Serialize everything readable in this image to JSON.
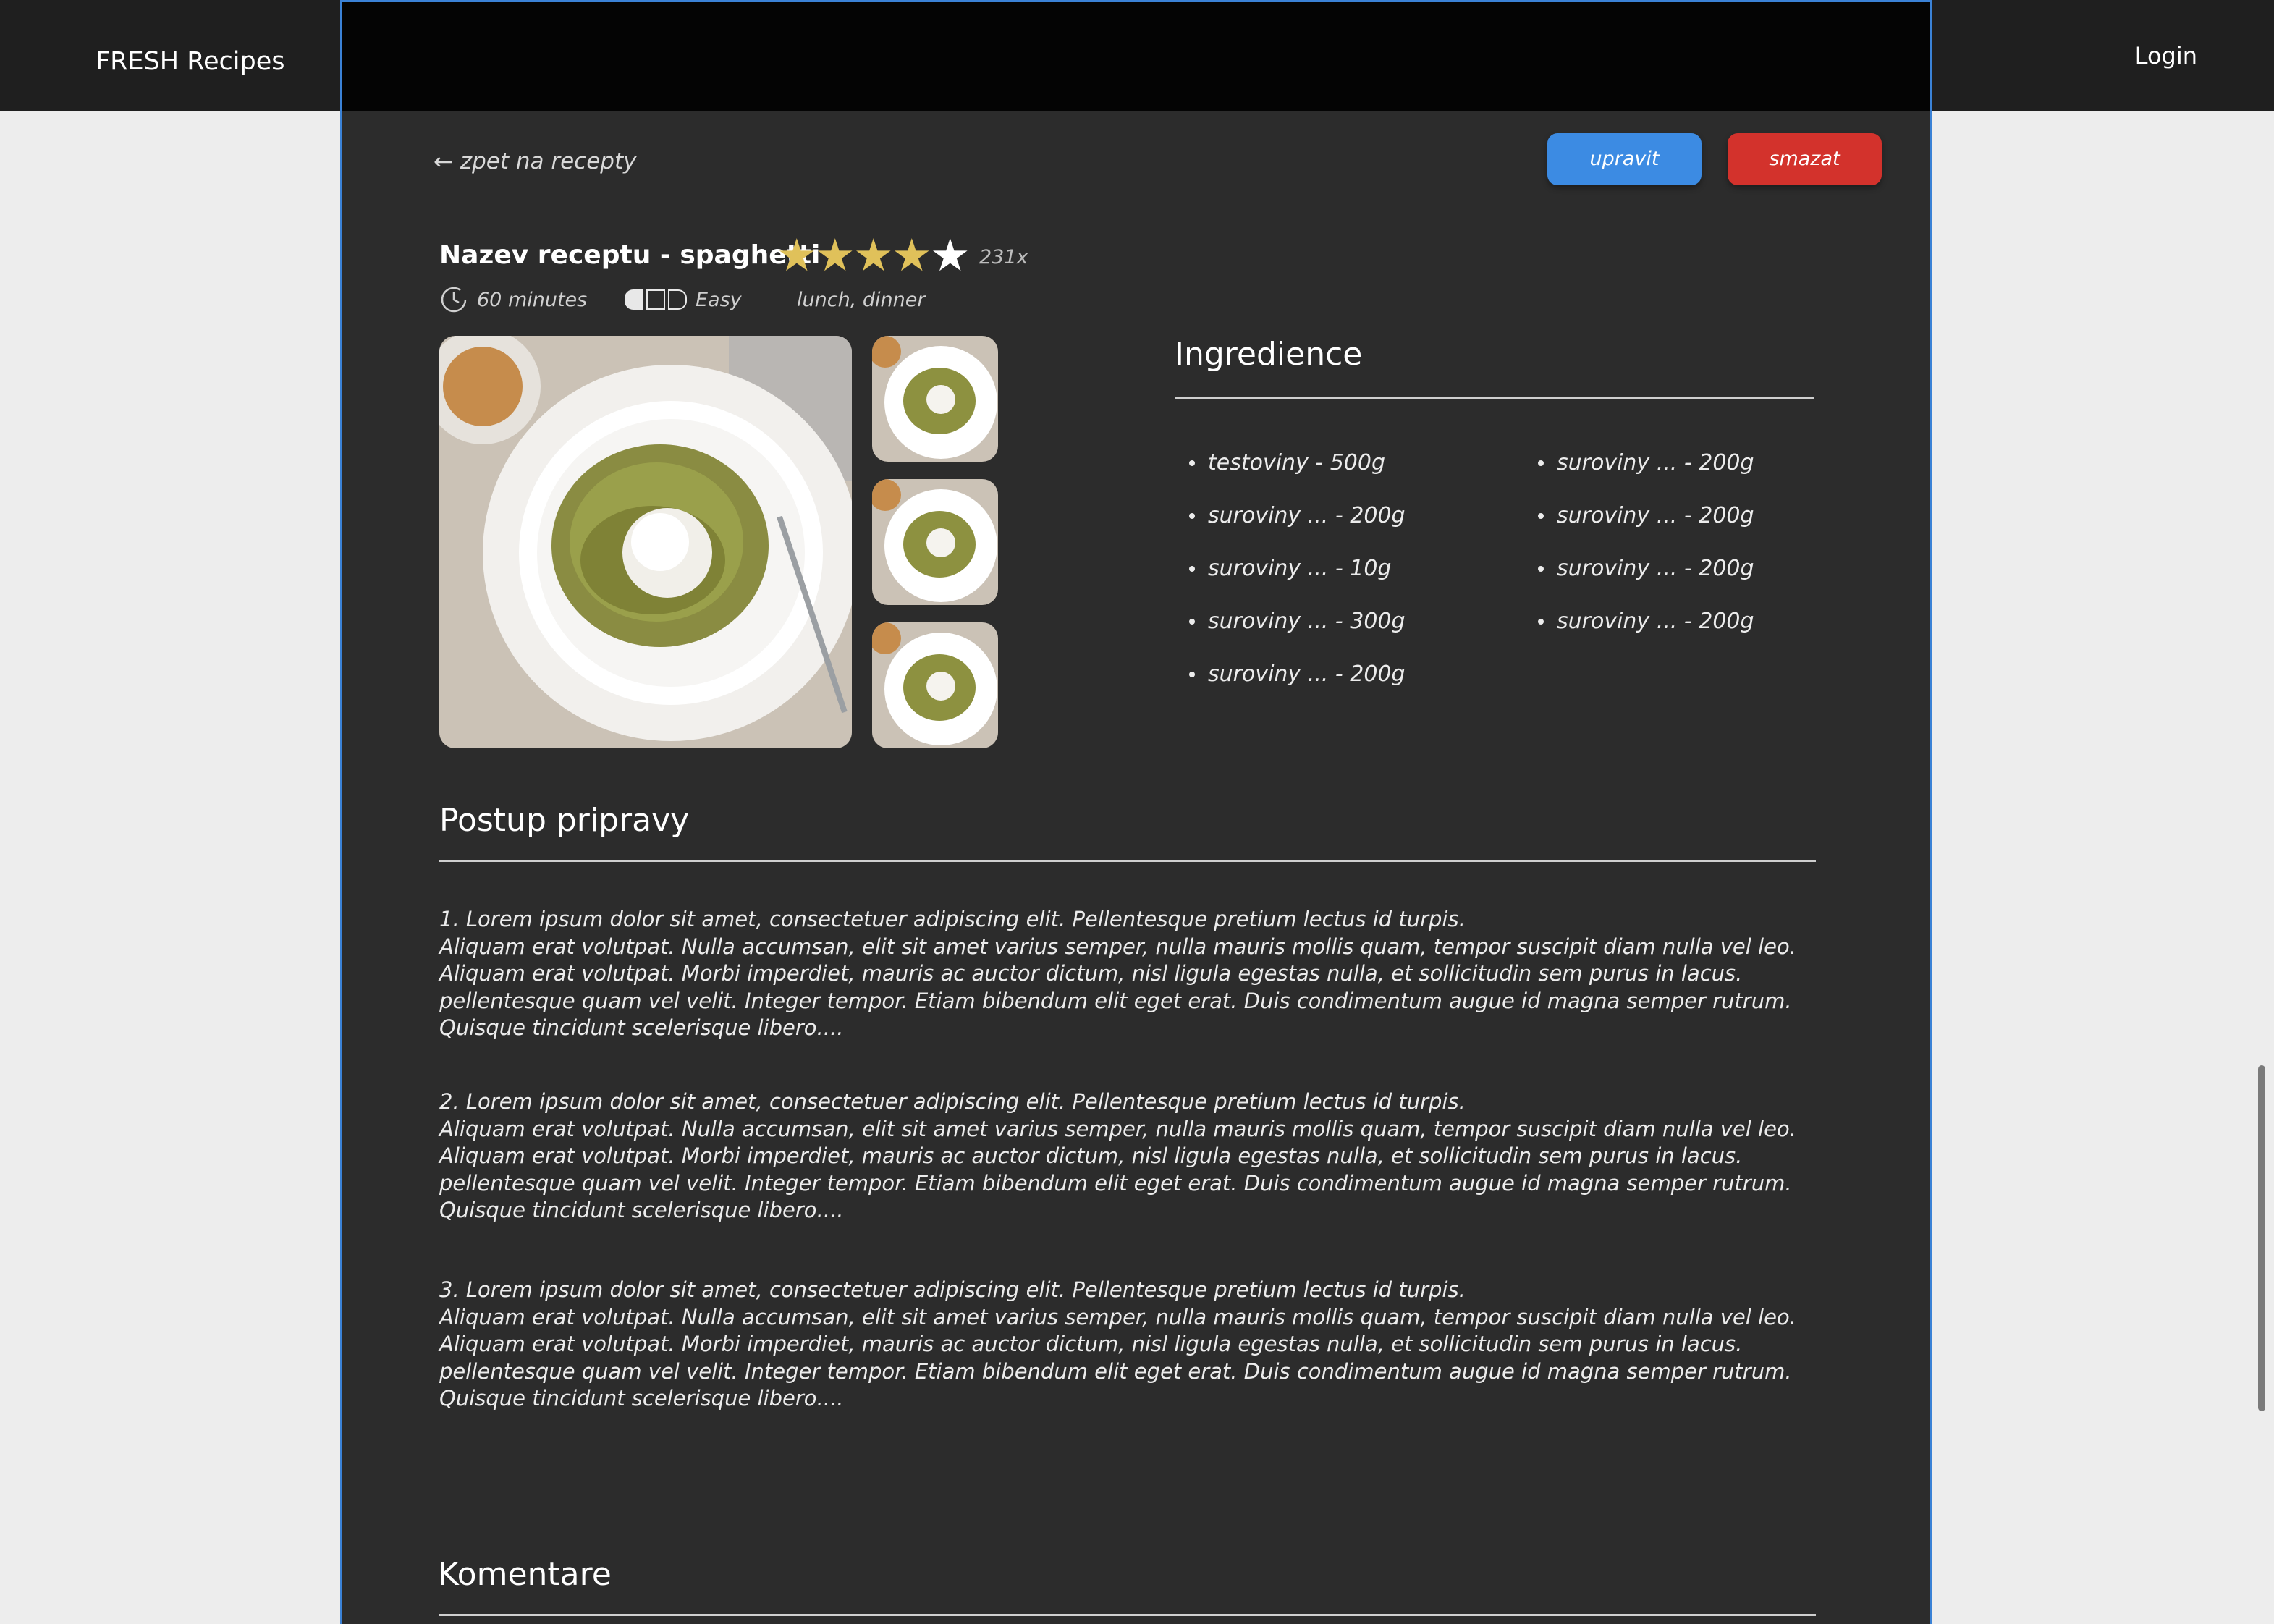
{
  "header": {
    "brand": "FRESH Recipes",
    "login": "Login"
  },
  "actions": {
    "back": "zpet na recepty",
    "edit": "upravit",
    "delete": "smazat"
  },
  "recipe": {
    "title": "Nazev receptu - spaghetti",
    "rating": {
      "value": 4,
      "max": 5,
      "count": "231x"
    },
    "time": "60 minutes",
    "difficulty": {
      "label": "Easy",
      "level": 1,
      "max": 3
    },
    "tags": "lunch, dinner"
  },
  "colors": {
    "accent_blue": "#3c8be3",
    "danger_red": "#d3322c",
    "star_gold": "#e0c15a",
    "panel_bg": "#2c2c2c"
  },
  "ingredients": {
    "title": "Ingredience",
    "col1": [
      "testoviny - 500g",
      "suroviny ... - 200g",
      "suroviny ... - 10g",
      "suroviny ... - 300g",
      "suroviny ... - 200g"
    ],
    "col2": [
      "suroviny ... - 200g",
      "suroviny ... - 200g",
      "suroviny ... - 200g",
      "suroviny ... - 200g"
    ]
  },
  "preparation": {
    "title": "Postup pripravy",
    "steps": [
      [
        " 1. Lorem ipsum dolor sit amet, consectetuer adipiscing elit. Pellentesque pretium lectus id turpis.",
        "Aliquam erat volutpat. Nulla accumsan, elit sit amet varius semper, nulla mauris mollis quam, tempor suscipit diam nulla vel leo.",
        "Aliquam erat volutpat. Morbi imperdiet, mauris ac auctor dictum, nisl ligula egestas nulla, et sollicitudin sem purus in lacus.",
        "pellentesque quam vel velit. Integer tempor. Etiam bibendum elit eget erat. Duis condimentum augue id magna semper rutrum.",
        "Quisque tincidunt scelerisque libero...."
      ],
      [
        " 2. Lorem ipsum dolor sit amet, consectetuer adipiscing elit. Pellentesque pretium lectus id turpis.",
        "Aliquam erat volutpat. Nulla accumsan, elit sit amet varius semper, nulla mauris mollis quam, tempor suscipit diam nulla vel leo.",
        "Aliquam erat volutpat. Morbi imperdiet, mauris ac auctor dictum, nisl ligula egestas nulla, et sollicitudin sem purus in lacus.",
        "pellentesque quam vel velit. Integer tempor. Etiam bibendum elit eget erat. Duis condimentum augue id magna semper rutrum.",
        "Quisque tincidunt scelerisque libero...."
      ],
      [
        " 3. Lorem ipsum dolor sit amet, consectetuer adipiscing elit. Pellentesque pretium lectus id turpis.",
        "Aliquam erat volutpat. Nulla accumsan, elit sit amet varius semper, nulla mauris mollis quam, tempor suscipit diam nulla vel leo.",
        "Aliquam erat volutpat. Morbi imperdiet, mauris ac auctor dictum, nisl ligula egestas nulla, et sollicitudin sem purus in lacus.",
        "pellentesque quam vel velit. Integer tempor. Etiam bibendum elit eget erat. Duis condimentum augue id magna semper rutrum.",
        "Quisque tincidunt scelerisque libero...."
      ]
    ]
  },
  "comments": {
    "title": "Komentare"
  }
}
